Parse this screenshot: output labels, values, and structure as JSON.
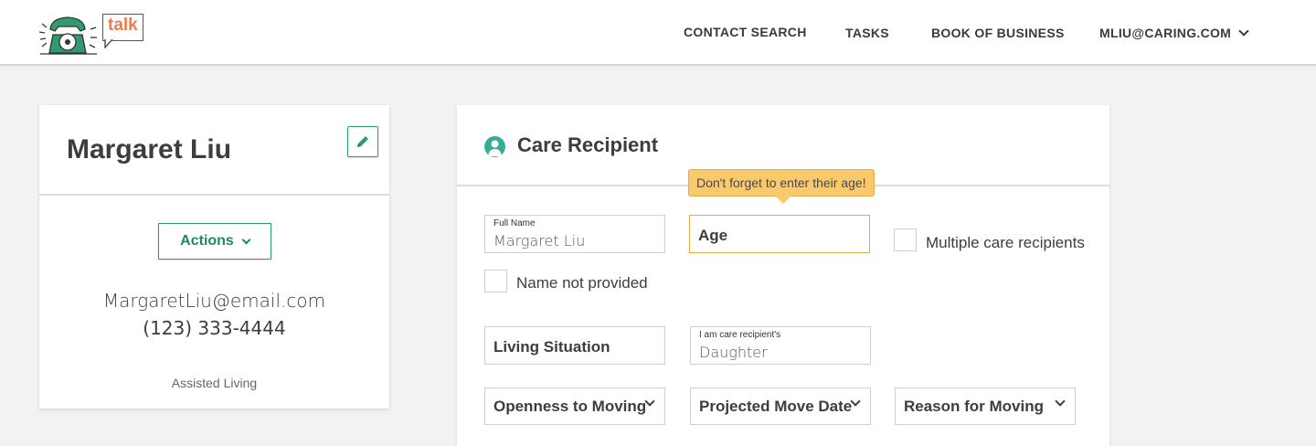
{
  "header": {
    "logo_text": "talk",
    "nav": {
      "contact_search": "CONTACT SEARCH",
      "tasks": "TASKS",
      "book_of_business": "BOOK OF BUSINESS",
      "user": "MLIU@CARING.COM"
    }
  },
  "contact_card": {
    "name": "Margaret Liu",
    "actions_label": "Actions",
    "email": "MargaretLiu@email.com",
    "phone": "(123) 333-4444",
    "tag": "Assisted Living"
  },
  "care_recipient": {
    "title": "Care Recipient",
    "tooltip": "Don't forget to enter their age!",
    "full_name": {
      "label": "Full Name",
      "value": "Margaret Liu"
    },
    "age": {
      "placeholder": "Age"
    },
    "multiple_recipients_label": "Multiple care recipients",
    "name_not_provided_label": "Name not provided",
    "living_situation": {
      "placeholder": "Living Situation"
    },
    "relationship": {
      "label": "I am care recipient's",
      "value": "Daughter"
    },
    "openness_to_moving": "Openness to Moving",
    "projected_move_date": "Projected Move Date",
    "reason_for_moving": "Reason for Moving"
  },
  "colors": {
    "accent_green": "#2a9d6f",
    "teal_icon": "#3aaa94",
    "tooltip_bg": "#f9c96b",
    "logo_orange": "#ee7a4a"
  }
}
